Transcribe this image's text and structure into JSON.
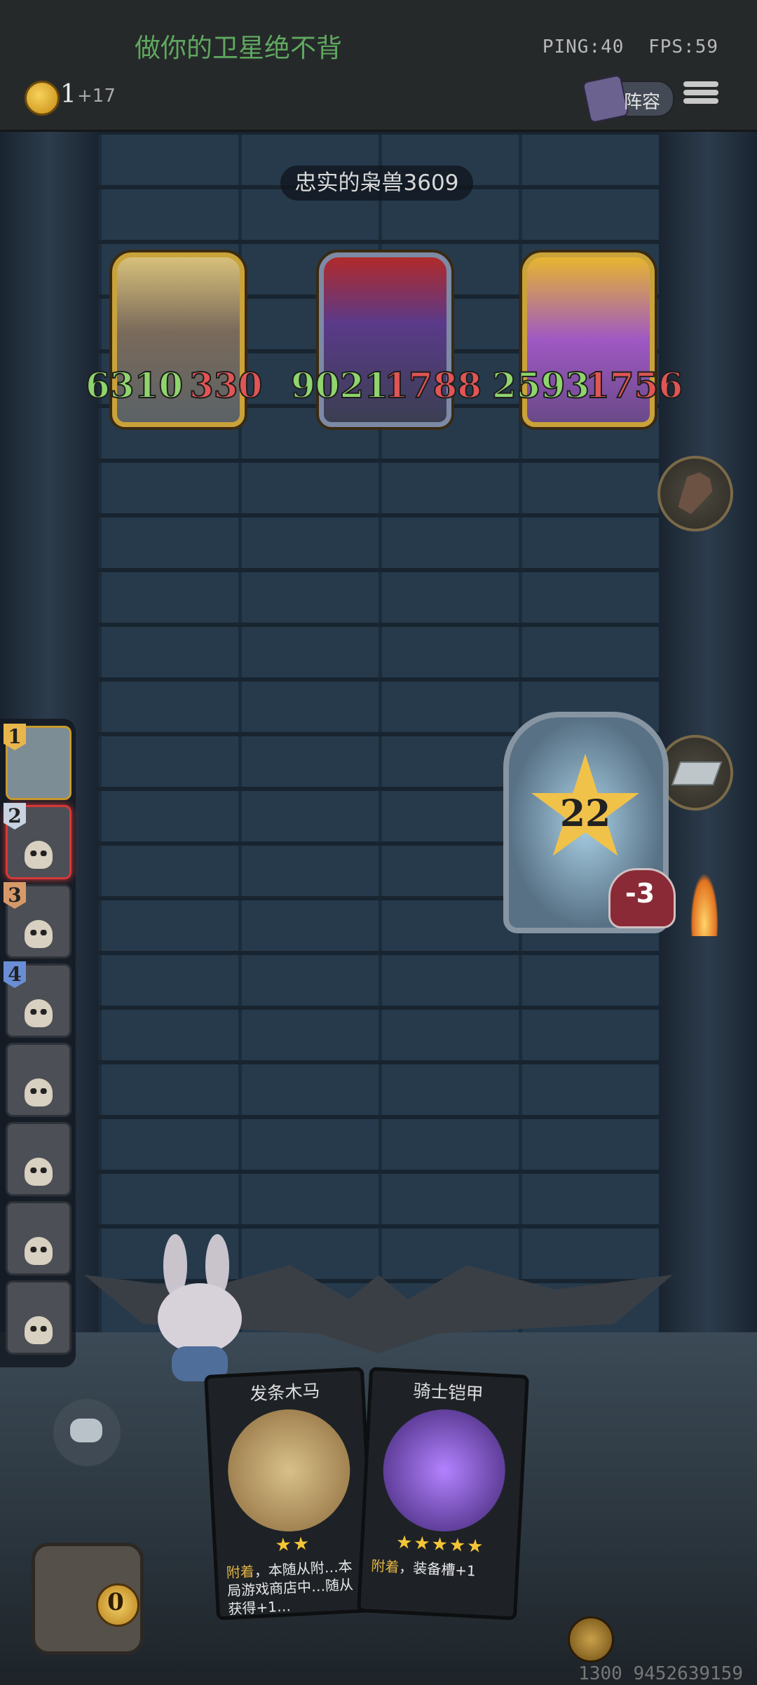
{
  "header": {
    "title": "做你的卫星绝不背",
    "ping": "PING:40",
    "fps": "FPS:59",
    "gold": "1",
    "gold_income": "+17",
    "lineup_label": "阵容"
  },
  "opponent": {
    "name": "忠实的枭兽3609"
  },
  "enemies": [
    {
      "attack": "6310",
      "health": "330"
    },
    {
      "attack": "9021",
      "health": "1788"
    },
    {
      "attack": "2593",
      "health": "1756"
    }
  ],
  "boss": {
    "level": "22",
    "health_change": "-3"
  },
  "roster": [
    {
      "rank": "1",
      "rank_color": "#e8b64a"
    },
    {
      "rank": "2",
      "rank_color": "#c8d2e0"
    },
    {
      "rank": "3",
      "rank_color": "#d69a6a"
    },
    {
      "rank": "4",
      "rank_color": "#6a8ed6"
    },
    {},
    {},
    {},
    {}
  ],
  "cards": [
    {
      "title": "发条木马",
      "stars": "★★",
      "desc_kw": "附着",
      "desc": "，本随从附…本局游戏商店中…随从获得+1…"
    },
    {
      "title": "骑士铠甲",
      "stars": "★★★★★",
      "desc_kw": "附着",
      "desc": "，装备槽+1"
    }
  ],
  "shop": {
    "gold": "0"
  },
  "footer": {
    "uid": "1300 9452639159"
  },
  "icons": {
    "coin": "coin-icon",
    "lineup": "lineup-book-icon",
    "menu": "hamburger-menu-icon",
    "coffin": "coffin-icon",
    "ingot": "ingot-icon",
    "chat": "chat-bubble-icon",
    "shop": "shop-chest-icon"
  }
}
